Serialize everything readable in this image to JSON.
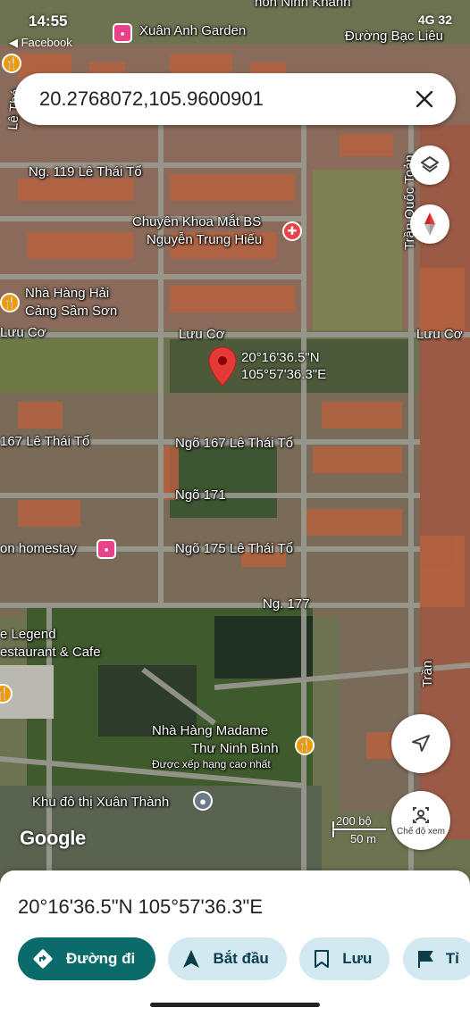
{
  "status_bar": {
    "time": "14:55",
    "signal": "4G",
    "battery": "32",
    "back_app": "Facebook"
  },
  "search": {
    "query": "20.2768072,105.9600901"
  },
  "map": {
    "labels": {
      "xuan_anh_garden": "Xuân Anh Garden",
      "ninh_khanh": "hôn Ninh Khánh",
      "duong_bac_lieu": "Đường Bạc Liêu",
      "le_thai_to_vertical": "Lê Thá",
      "ng119": "Ng. 119 Lê Thái Tổ",
      "chuyen_khoa_mat": "Chuyên Khoa Mắt BS",
      "nguyen_trung_hieu": "Nguyễn Trung Hiếu",
      "nha_hang_hai": "Nhà Hàng Hải",
      "cang_sam_son": "Cảng Sầm Sơn",
      "luu_co_left": "Lưu Cơ",
      "luu_co_mid": "Lưu Cơ",
      "luu_co_right": "Lưu Cơ",
      "tran_quoc_toan": "Trần Quốc Toản",
      "ngo167_left": "167 Lê Thái Tổ",
      "ngo167": "Ngõ 167 Lê Thái Tổ",
      "ngo171": "Ngõ 171",
      "homestay": "on homestay",
      "ngo175": "Ngõ 175 Lê Thái Tổ",
      "ng177": "Ng. 177",
      "legend1": "e Legend",
      "legend2": "estaurant & Cafe",
      "madame1": "Nhà Hàng Madame",
      "madame2": "Thư Ninh Bình",
      "madame3": "Được xếp hạng cao nhất",
      "khu_do_thi": "Khu đô thị Xuân Thành",
      "tran_right": "Trần"
    },
    "pin": {
      "line1": "20°16'36.5\"N",
      "line2": "105°57'36.3\"E"
    },
    "google": "Google",
    "scale": {
      "top": "200 bộ",
      "bottom": "50 m"
    },
    "street_view_caption": "Chế độ xem"
  },
  "sheet": {
    "coords": "20°16'36.5\"N 105°57'36.3\"E",
    "actions": [
      {
        "label": "Đường đi"
      },
      {
        "label": "Bắt đầu"
      },
      {
        "label": "Lưu"
      },
      {
        "label": "Tỉ"
      }
    ]
  },
  "colors": {
    "primary": "#0b6b6b",
    "chip": "#d3e9f2",
    "pin": "#e53935"
  }
}
